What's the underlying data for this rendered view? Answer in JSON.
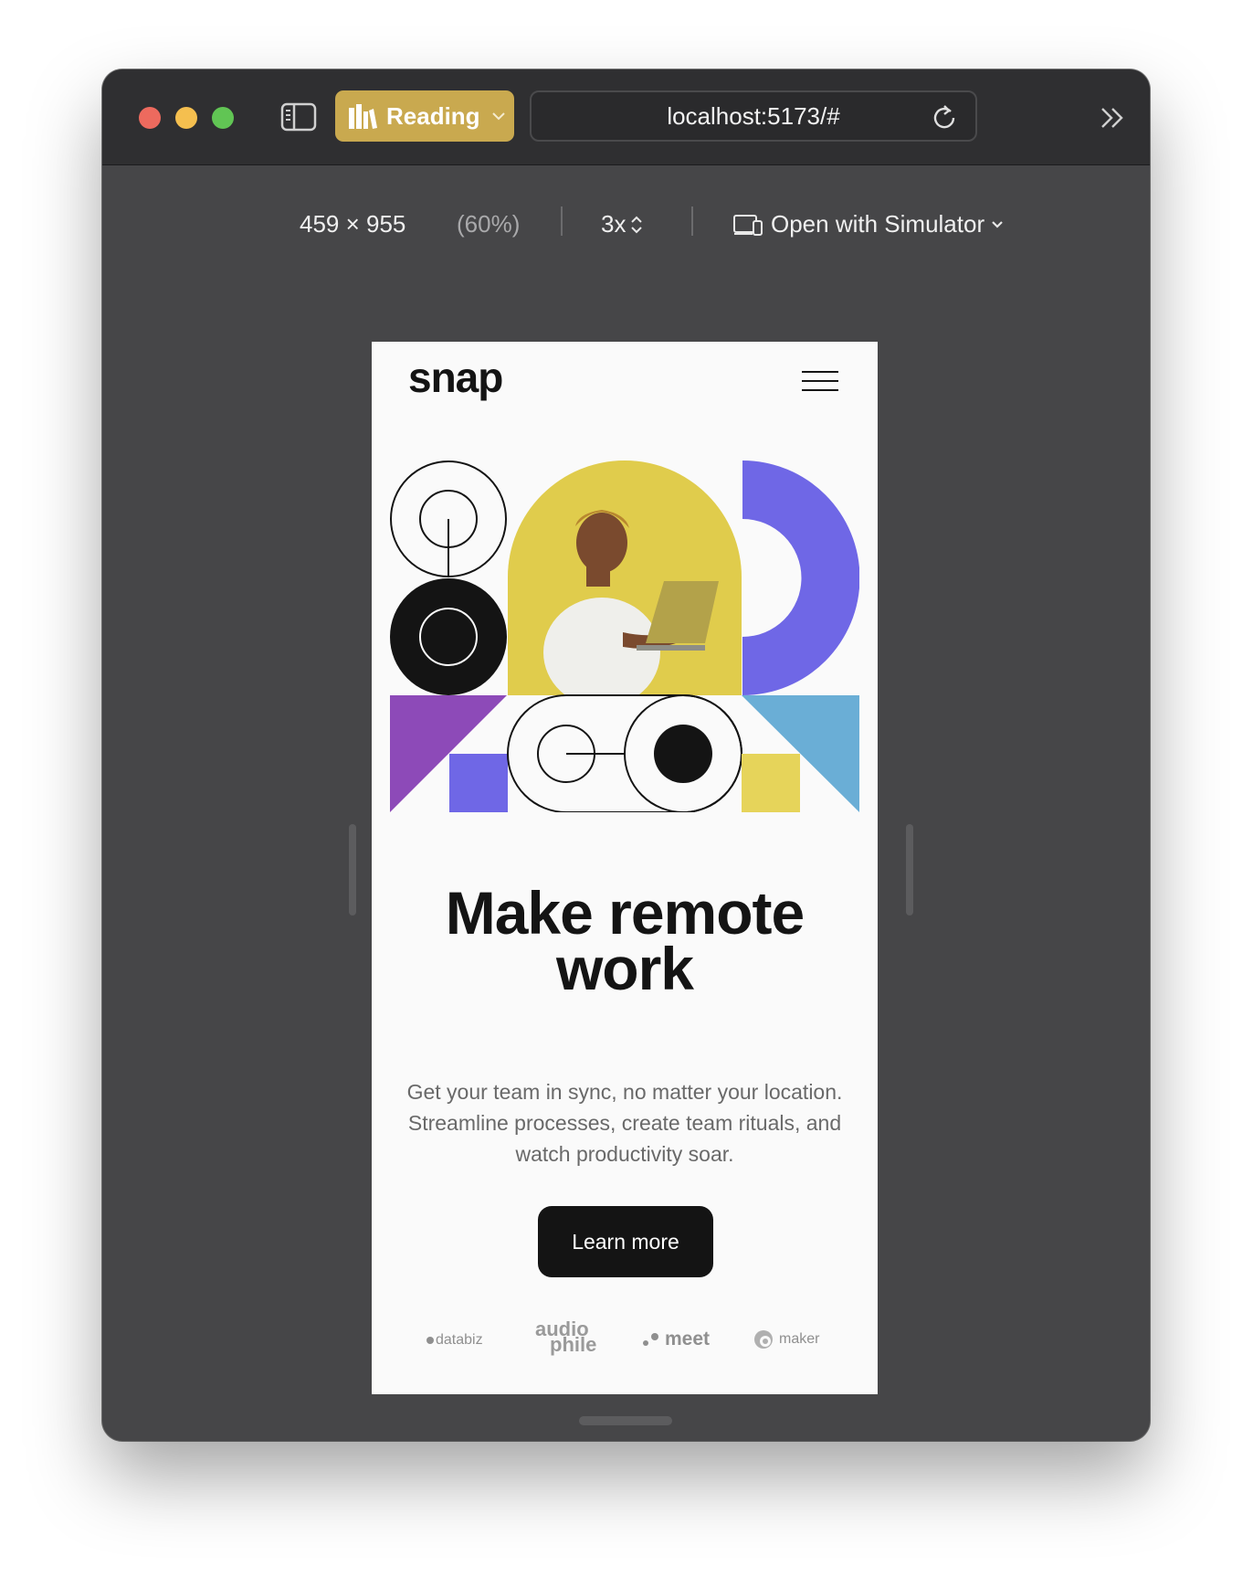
{
  "browser": {
    "reading_label": "Reading",
    "url": "localhost:5173/#"
  },
  "device_bar": {
    "dimensions": "459 × 955",
    "zoom": "(60%)",
    "scale": "3x",
    "simulator_label": "Open with Simulator"
  },
  "page": {
    "logo": "snap",
    "headline_line1": "Make remote",
    "headline_line2": "work",
    "lede_line1": "Get your team in sync, no matter your location.",
    "lede_line2": "Streamline processes, create team rituals, and",
    "lede_line3": "watch productivity soar.",
    "cta_label": "Learn more",
    "clients": {
      "databiz": "databiz",
      "audiophile_top": "audio",
      "audiophile_bottom": "phile",
      "meet": "meet",
      "maker": "maker"
    }
  },
  "colors": {
    "accent_gold": "#c9a94f",
    "hero_yellow": "#e6d45a",
    "hero_purple": "#6f67e6",
    "hero_violet": "#8d4ab8",
    "hero_blue": "#6aaed6",
    "ink": "#141414"
  },
  "icons": [
    "sidebar-icon",
    "reading-list-icon",
    "chevron-down-icon",
    "reload-icon",
    "chevron-double-right-icon",
    "device-icon",
    "hamburger-menu-icon"
  ]
}
